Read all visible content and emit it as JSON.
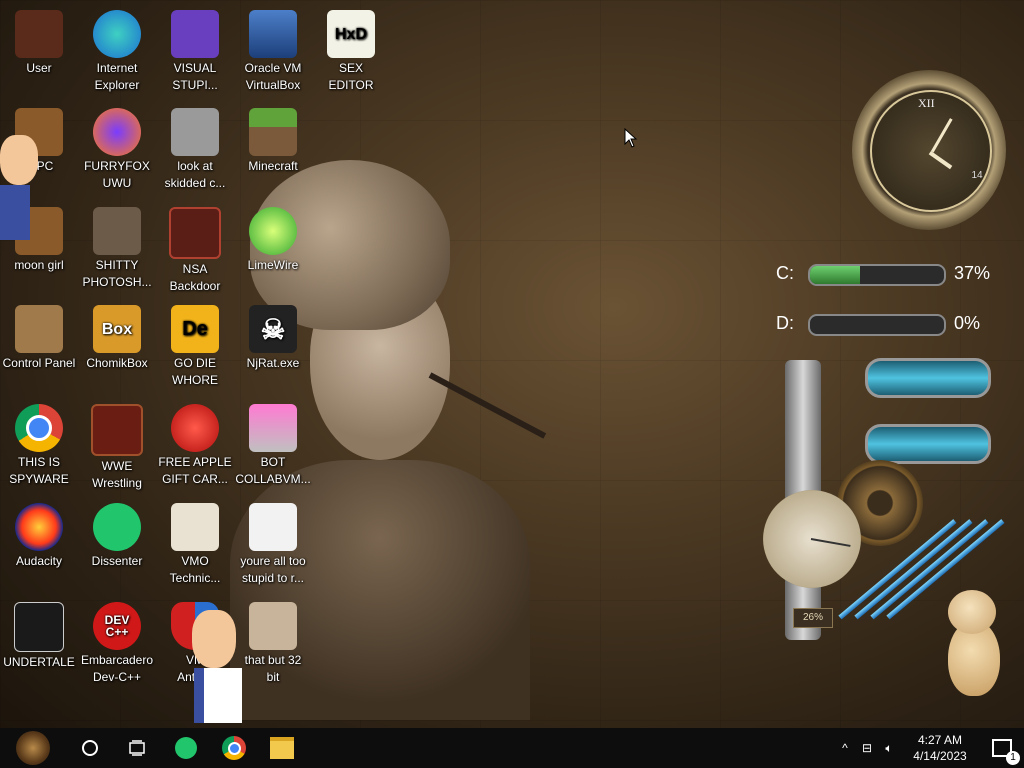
{
  "desktop": {
    "icons": [
      {
        "label": "User",
        "badge": ""
      },
      {
        "label": "Internet\nExplorer",
        "badge": ""
      },
      {
        "label": "VISUAL\nSTUPI...",
        "badge": ""
      },
      {
        "label": "Oracle VM\nVirtualBox",
        "badge": ""
      },
      {
        "label": "SEX\nEDITOR",
        "badge": "HxD"
      },
      {
        "label": "is PC",
        "badge": ""
      },
      {
        "label": "FURRYFOX\nUWU",
        "badge": ""
      },
      {
        "label": "look at\nskidded c...",
        "badge": ""
      },
      {
        "label": "Minecraft",
        "badge": ""
      },
      {
        "label": "moon girl",
        "badge": ""
      },
      {
        "label": "SHITTY\nPHOTOSH...",
        "badge": ""
      },
      {
        "label": "NSA\nBackdoor",
        "badge": ""
      },
      {
        "label": "LimeWire",
        "badge": ""
      },
      {
        "label": "Control Panel",
        "badge": ""
      },
      {
        "label": "ChomikBox",
        "badge": "Box"
      },
      {
        "label": "GO DIE\nWHORE",
        "badge": "De"
      },
      {
        "label": "NjRat.exe",
        "badge": ""
      },
      {
        "label": "THIS IS\nSPYWARE",
        "badge": ""
      },
      {
        "label": "WWE\nWrestling",
        "badge": ""
      },
      {
        "label": "FREE APPLE\nGIFT CAR...",
        "badge": ""
      },
      {
        "label": "BOT\nCOLLABVM...",
        "badge": ""
      },
      {
        "label": "Audacity",
        "badge": ""
      },
      {
        "label": "Dissenter",
        "badge": ""
      },
      {
        "label": "VMO\nTechnic...",
        "badge": ""
      },
      {
        "label": "youre all too\nstupid to r...",
        "badge": ""
      },
      {
        "label": "UNDERTALE",
        "badge": ""
      },
      {
        "label": "Embarcadero\nDev-C++",
        "badge": "DEV\nC++"
      },
      {
        "label": "VM\nAntiv...",
        "badge": ""
      },
      {
        "label": "that but 32\nbit",
        "badge": ""
      }
    ]
  },
  "widgets": {
    "clock": {
      "roman_top": "XII",
      "day": "14",
      "hour": 4,
      "minute": 27
    },
    "drives": [
      {
        "label": "C:",
        "percent_text": "37%",
        "fill": 0.37
      },
      {
        "label": "D:",
        "percent_text": "0%",
        "fill": 0.0
      }
    ],
    "cpu_meter_label": "26%"
  },
  "taskbar": {
    "time": "4:27 AM",
    "date": "4/14/2023",
    "pinned": [
      "search-icon",
      "task-view-icon",
      "dissenter-icon",
      "chrome-icon",
      "file-explorer-icon"
    ],
    "notification_count": "1"
  },
  "colors": {
    "taskbar_bg": "#0d0d0d",
    "drive_fill": "#4caf50",
    "tank": "#4fc3e0"
  }
}
